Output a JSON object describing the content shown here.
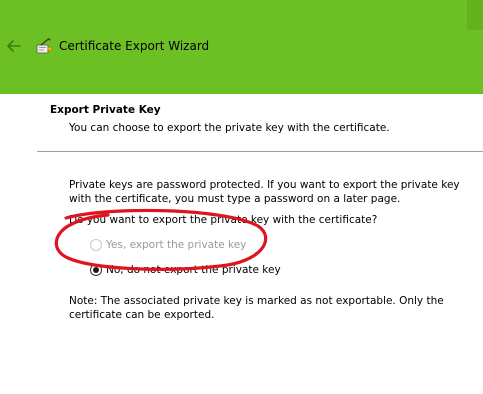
{
  "window": {
    "title": "Certificate Export Wizard",
    "titlebar_color": "#6cc024"
  },
  "icons": {
    "back": "back-arrow-icon",
    "wizard": "certificate-wizard-icon"
  },
  "header": {
    "title": "Export Private Key",
    "subtitle": "You can choose to export the private key with the certificate."
  },
  "body": {
    "paragraph": "Private keys are password protected. If you want to export the private key with the certificate, you must type a password on a later page.",
    "question": "Do you want to export the private key with the certificate?",
    "options": [
      {
        "label": "Yes, export the private key",
        "selected": false,
        "disabled": true
      },
      {
        "label": "No, do not export the private key",
        "selected": true,
        "disabled": false
      }
    ],
    "note": "Note: The associated private key is marked as not exportable. Only the certificate can be exported."
  },
  "annotation": {
    "color": "#e0141e",
    "shape": "hand-drawn ellipse around the disabled \"Yes, export the private key\" option"
  }
}
